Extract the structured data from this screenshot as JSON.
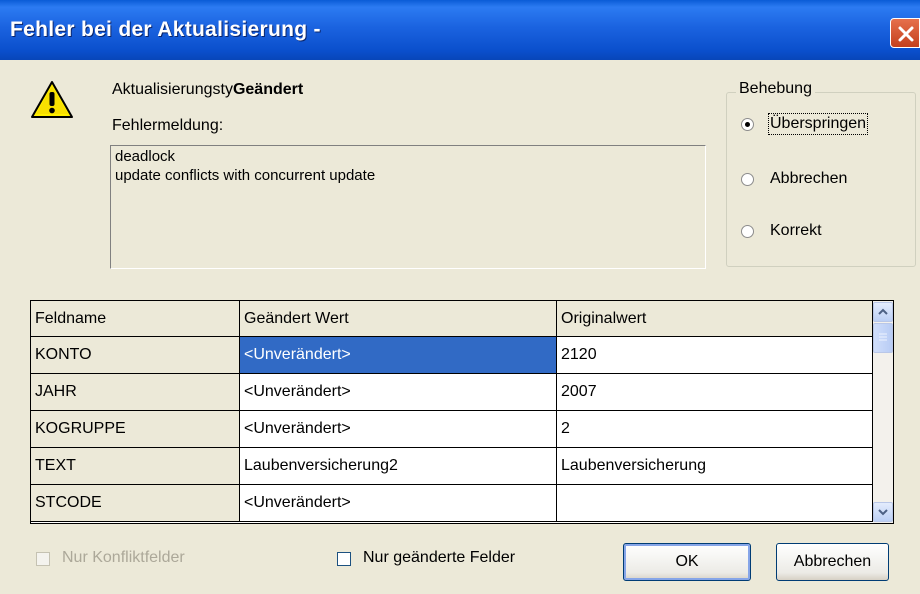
{
  "window": {
    "title": "Fehler bei der Aktualisierung -"
  },
  "error": {
    "type_label": "Aktualisierungsty",
    "type_value": "Geändert",
    "message_label": "Fehlermeldung:",
    "message_lines": [
      "deadlock",
      "update conflicts with concurrent update"
    ]
  },
  "resolution": {
    "title": "Behebung",
    "options": [
      {
        "label": "Überspringen",
        "selected": true
      },
      {
        "label": "Abbrechen",
        "selected": false
      },
      {
        "label": "Korrekt",
        "selected": false
      }
    ]
  },
  "grid": {
    "columns": [
      "Feldname",
      "Geändert Wert",
      "Originalwert"
    ],
    "rows": [
      [
        "KONTO",
        "<Unverändert>",
        "2120"
      ],
      [
        "JAHR",
        "<Unverändert>",
        "2007"
      ],
      [
        "KOGRUPPE",
        "<Unverändert>",
        "2"
      ],
      [
        "TEXT",
        "Laubenversicherung2",
        "Laubenversicherung"
      ],
      [
        "STCODE",
        "<Unverändert>",
        ""
      ]
    ],
    "selected_row": 0
  },
  "footer": {
    "only_conflicts_label": "Nur Konfliktfelder",
    "only_changed_label": "Nur geänderte Felder",
    "ok_label": "OK",
    "cancel_label": "Abbrechen"
  },
  "colors": {
    "title_bar": "#0A4FCC",
    "selection": "#316AC5",
    "dialog_bg": "#ECE9D8"
  }
}
